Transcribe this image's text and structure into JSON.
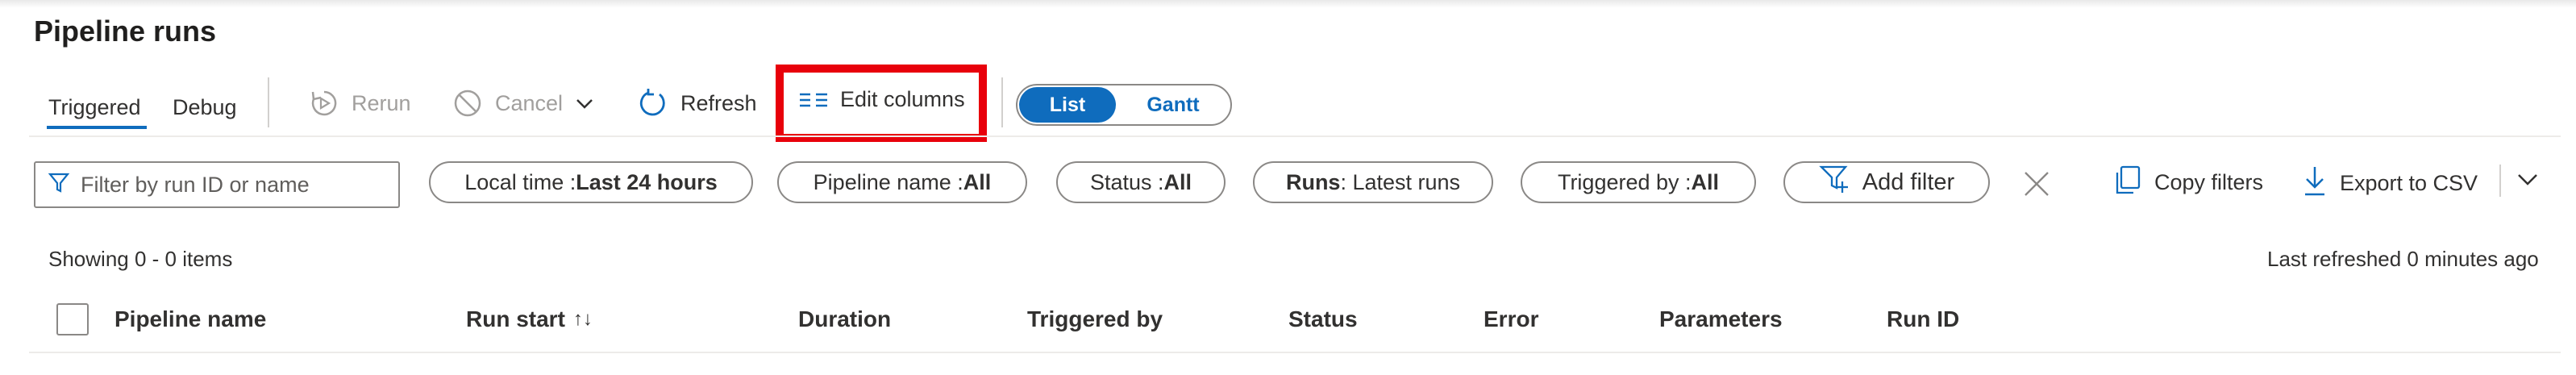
{
  "page": {
    "title": "Pipeline runs"
  },
  "tabs": {
    "triggered": "Triggered",
    "debug": "Debug"
  },
  "toolbar": {
    "rerun": "Rerun",
    "cancel": "Cancel",
    "refresh": "Refresh",
    "edit_columns": "Edit columns"
  },
  "view_toggle": {
    "list": "List",
    "gantt": "Gantt",
    "selected": "List"
  },
  "filters": {
    "search_placeholder": "Filter by run ID or name",
    "local_time": {
      "label": "Local time : ",
      "value": "Last 24 hours"
    },
    "pipeline_name": {
      "label": "Pipeline name : ",
      "value": "All"
    },
    "status": {
      "label": "Status : ",
      "value": "All"
    },
    "runs": {
      "label": "Runs",
      "value": " : Latest runs"
    },
    "triggered_by": {
      "label": "Triggered by : ",
      "value": "All"
    },
    "add_filter": "Add filter",
    "copy_filters": "Copy filters",
    "export_csv": "Export to CSV"
  },
  "summary": {
    "showing": "Showing 0 - 0 items",
    "last_refreshed": "Last refreshed 0 minutes ago"
  },
  "table": {
    "columns": [
      "Pipeline name",
      "Run start",
      "Duration",
      "Triggered by",
      "Status",
      "Error",
      "Parameters",
      "Run ID"
    ],
    "sort_glyph": "↑↓"
  },
  "colors": {
    "accent": "#0f6cbd",
    "highlight": "#e8000b"
  }
}
